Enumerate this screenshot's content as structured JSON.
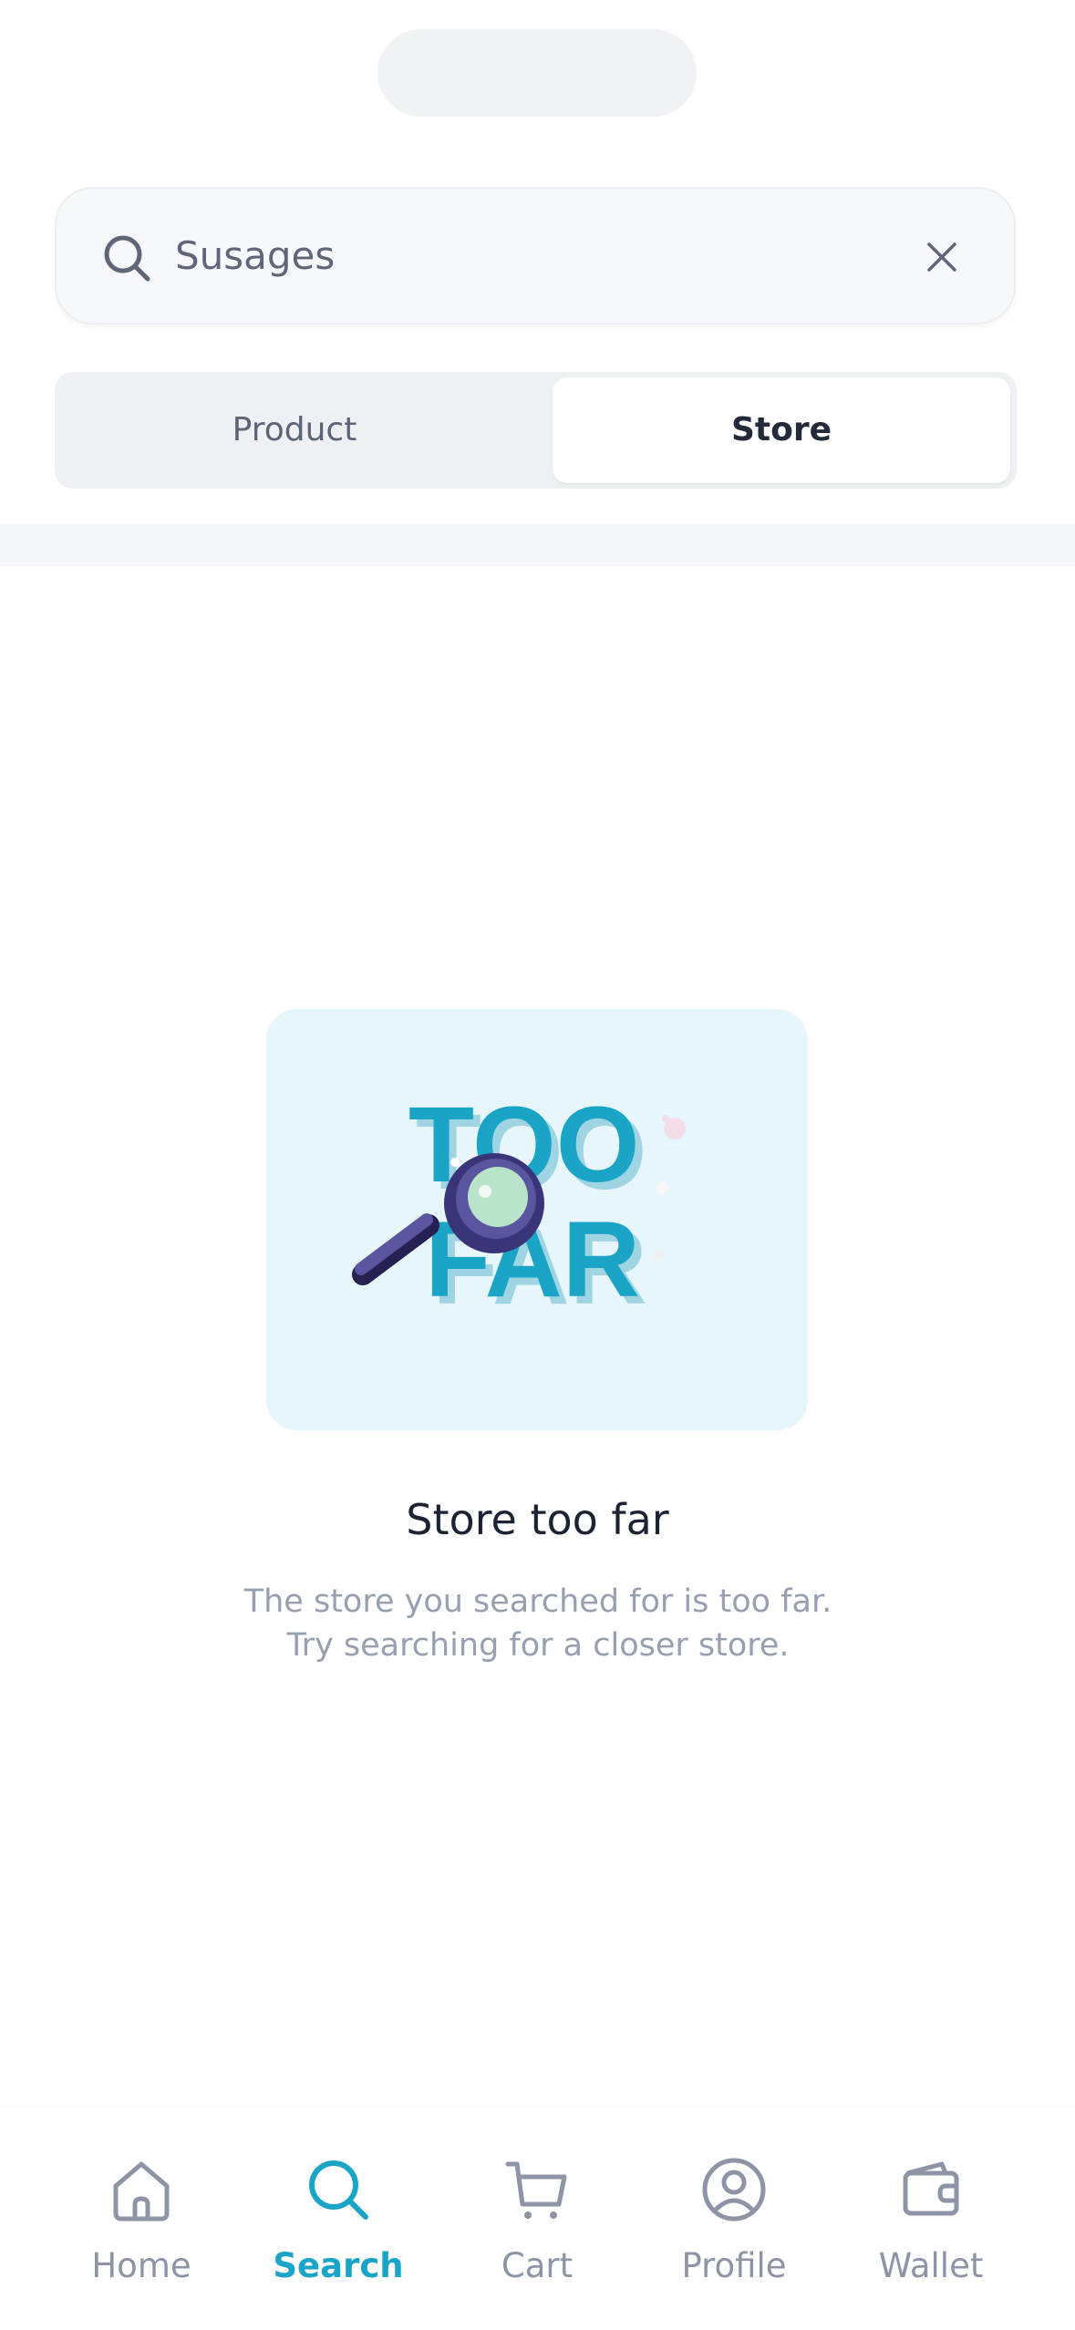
{
  "search": {
    "value": "Susages",
    "icon": "search-icon",
    "clear_icon": "close-icon"
  },
  "segmented": {
    "tabs": [
      {
        "label": "Product",
        "selected": false
      },
      {
        "label": "Store",
        "selected": true
      }
    ]
  },
  "empty_state": {
    "illustration_text": [
      "TOO",
      "FAR"
    ],
    "title": "Store too far",
    "description": "The store you searched for is too far. Try searching for a closer store."
  },
  "tab_bar": {
    "items": [
      {
        "label": "Home",
        "icon": "home-icon",
        "active": false
      },
      {
        "label": "Search",
        "icon": "search-icon",
        "active": true
      },
      {
        "label": "Cart",
        "icon": "cart-icon",
        "active": false
      },
      {
        "label": "Profile",
        "icon": "profile-icon",
        "active": false
      },
      {
        "label": "Wallet",
        "icon": "wallet-icon",
        "active": false
      }
    ]
  },
  "colors": {
    "accent": "#1aa5c7",
    "illustration_bg": "#e6f6fa",
    "magnifier": "#4a4590"
  }
}
